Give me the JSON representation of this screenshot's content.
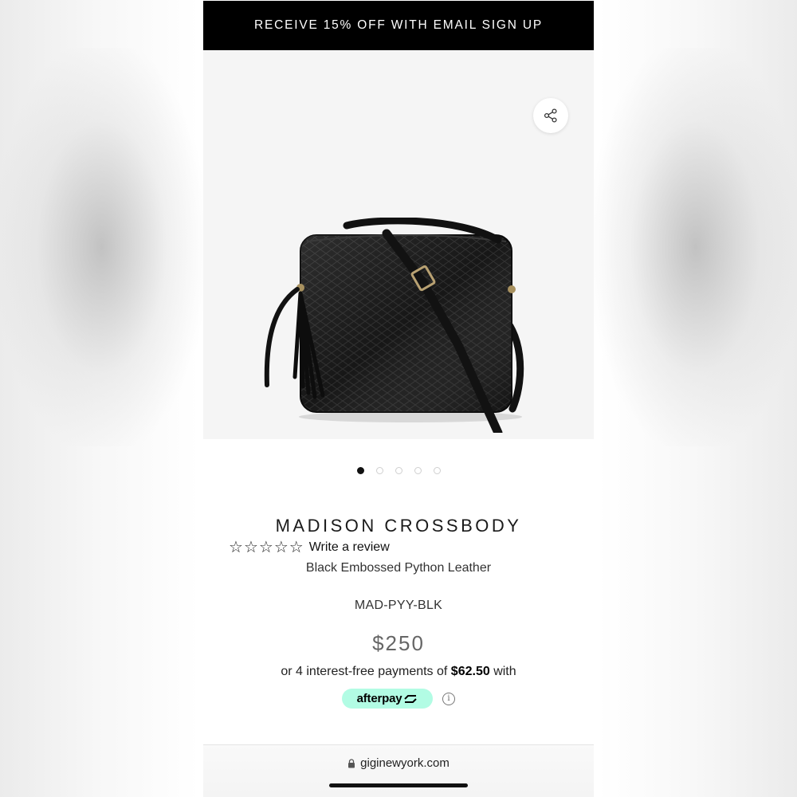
{
  "promo_banner": {
    "text": "RECEIVE 15% OFF WITH EMAIL SIGN UP"
  },
  "gallery": {
    "image_count": 5,
    "active_index": 0
  },
  "product": {
    "name": "MADISON CROSSBODY",
    "rating": {
      "stars": 0,
      "max": 5,
      "review_link": "Write a review"
    },
    "variant": "Black Embossed Python Leather",
    "sku": "MAD-PYY-BLK",
    "price": "$250"
  },
  "payment": {
    "prefix": "or 4 interest-free payments of",
    "amount": "$62.50",
    "suffix": "with",
    "provider": "afterpay",
    "provider_color": "#b2fce4"
  },
  "browser": {
    "url": "giginewyork.com"
  },
  "colors": {
    "banner_bg": "#000000",
    "banner_text": "#ffffff"
  }
}
